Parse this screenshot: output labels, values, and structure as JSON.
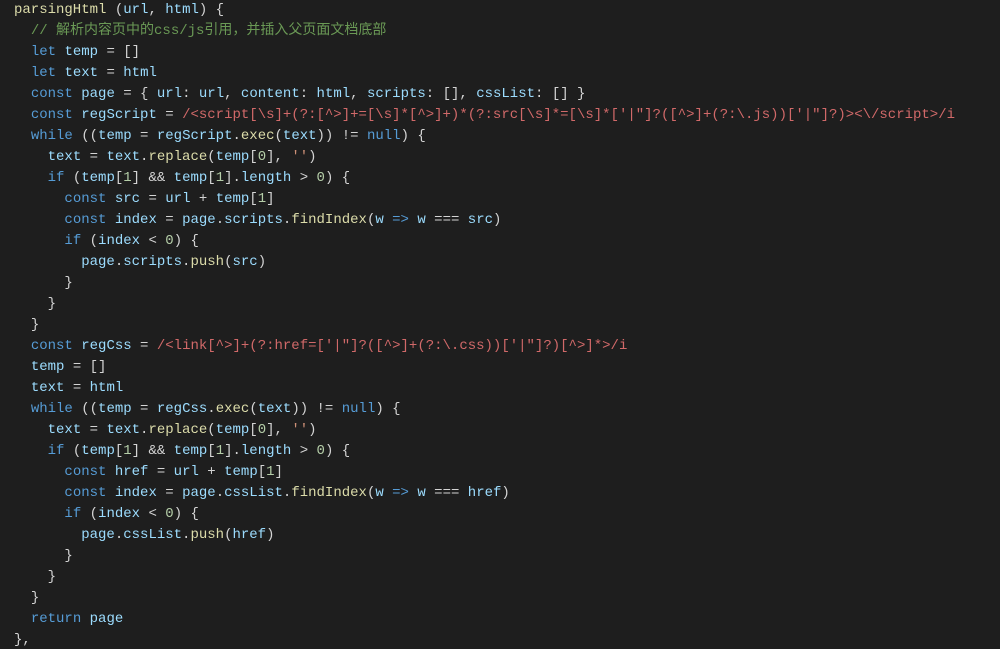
{
  "code": {
    "lines": [
      {
        "i": 0,
        "h": "<span class='fn'>parsingHtml</span><span class='pnc'> (</span><span class='prm'>url</span><span class='pnc'>, </span><span class='prm'>html</span><span class='pnc'>) {</span>"
      },
      {
        "i": 1,
        "h": "<span class='cmt'>// 解析内容页中的css/js引用，并插入父页面文档底部</span>"
      },
      {
        "i": 1,
        "h": "<span class='kw'>let</span><span class='pnc'> </span><span class='prm'>temp</span><span class='pnc'> = []</span>"
      },
      {
        "i": 1,
        "h": "<span class='kw'>let</span><span class='pnc'> </span><span class='prm'>text</span><span class='pnc'> = </span><span class='prm'>html</span>"
      },
      {
        "i": 1,
        "h": "<span class='kw'>const</span><span class='pnc'> </span><span class='prm'>page</span><span class='pnc'> = { </span><span class='prm'>url</span><span class='pnc'>: </span><span class='prm'>url</span><span class='pnc'>, </span><span class='prm'>content</span><span class='pnc'>: </span><span class='prm'>html</span><span class='pnc'>, </span><span class='prm'>scripts</span><span class='pnc'>: [], </span><span class='prm'>cssList</span><span class='pnc'>: [] }</span>"
      },
      {
        "i": 1,
        "h": "<span class='kw'>const</span><span class='pnc'> </span><span class='prm'>regScript</span><span class='pnc'> = </span><span class='rgx'>/&lt;script[\\s]+(?:[^&gt;]+=[\\s]*[^&gt;]+)*(?:src[\\s]*=[\\s]*['|\"]?([^&gt;]+(?:\\.js))['|\"]?)&gt;&lt;\\/script&gt;/i</span>"
      },
      {
        "i": 1,
        "h": "<span class='kw'>while</span><span class='pnc'> ((</span><span class='prm'>temp</span><span class='pnc'> = </span><span class='prm'>regScript</span><span class='pnc'>.</span><span class='fn'>exec</span><span class='pnc'>(</span><span class='prm'>text</span><span class='pnc'>)) != </span><span class='kw'>null</span><span class='pnc'>) {</span>"
      },
      {
        "i": 2,
        "h": "<span class='prm'>text</span><span class='pnc'> = </span><span class='prm'>text</span><span class='pnc'>.</span><span class='fn'>replace</span><span class='pnc'>(</span><span class='prm'>temp</span><span class='pnc'>[</span><span class='num'>0</span><span class='pnc'>], </span><span class='str'>''</span><span class='pnc'>)</span>"
      },
      {
        "i": 2,
        "h": "<span class='kw'>if</span><span class='pnc'> (</span><span class='prm'>temp</span><span class='pnc'>[</span><span class='num'>1</span><span class='pnc'>] &amp;&amp; </span><span class='prm'>temp</span><span class='pnc'>[</span><span class='num'>1</span><span class='pnc'>].</span><span class='prm'>length</span><span class='pnc'> &gt; </span><span class='num'>0</span><span class='pnc'>) {</span>"
      },
      {
        "i": 3,
        "h": "<span class='kw'>const</span><span class='pnc'> </span><span class='prm'>src</span><span class='pnc'> = </span><span class='prm'>url</span><span class='pnc'> + </span><span class='prm'>temp</span><span class='pnc'>[</span><span class='num'>1</span><span class='pnc'>]</span>"
      },
      {
        "i": 3,
        "h": "<span class='kw'>const</span><span class='pnc'> </span><span class='prm'>index</span><span class='pnc'> = </span><span class='prm'>page</span><span class='pnc'>.</span><span class='prm'>scripts</span><span class='pnc'>.</span><span class='fn'>findIndex</span><span class='pnc'>(</span><span class='prm'>w</span><span class='pnc'> </span><span class='kw'>=&gt;</span><span class='pnc'> </span><span class='prm'>w</span><span class='pnc'> === </span><span class='prm'>src</span><span class='pnc'>)</span>"
      },
      {
        "i": 3,
        "h": "<span class='kw'>if</span><span class='pnc'> (</span><span class='prm'>index</span><span class='pnc'> &lt; </span><span class='num'>0</span><span class='pnc'>) {</span>"
      },
      {
        "i": 4,
        "h": "<span class='prm'>page</span><span class='pnc'>.</span><span class='prm'>scripts</span><span class='pnc'>.</span><span class='fn'>push</span><span class='pnc'>(</span><span class='prm'>src</span><span class='pnc'>)</span>"
      },
      {
        "i": 3,
        "h": "<span class='pnc'>}</span>"
      },
      {
        "i": 2,
        "h": "<span class='pnc'>}</span>"
      },
      {
        "i": 1,
        "h": "<span class='pnc'>}</span>"
      },
      {
        "i": 1,
        "h": "<span class='kw'>const</span><span class='pnc'> </span><span class='prm'>regCss</span><span class='pnc'> = </span><span class='rgx'>/&lt;link[^&gt;]+(?:href=['|\"]?([^&gt;]+(?:\\.css))['|\"]?)[^&gt;]*&gt;/i</span>"
      },
      {
        "i": 1,
        "h": "<span class='prm'>temp</span><span class='pnc'> = []</span>"
      },
      {
        "i": 1,
        "h": "<span class='prm'>text</span><span class='pnc'> = </span><span class='prm'>html</span>"
      },
      {
        "i": 1,
        "h": "<span class='kw'>while</span><span class='pnc'> ((</span><span class='prm'>temp</span><span class='pnc'> = </span><span class='prm'>regCss</span><span class='pnc'>.</span><span class='fn'>exec</span><span class='pnc'>(</span><span class='prm'>text</span><span class='pnc'>)) != </span><span class='kw'>null</span><span class='pnc'>) {</span>"
      },
      {
        "i": 2,
        "h": "<span class='prm'>text</span><span class='pnc'> = </span><span class='prm'>text</span><span class='pnc'>.</span><span class='fn'>replace</span><span class='pnc'>(</span><span class='prm'>temp</span><span class='pnc'>[</span><span class='num'>0</span><span class='pnc'>], </span><span class='str'>''</span><span class='pnc'>)</span>"
      },
      {
        "i": 2,
        "h": "<span class='kw'>if</span><span class='pnc'> (</span><span class='prm'>temp</span><span class='pnc'>[</span><span class='num'>1</span><span class='pnc'>] &amp;&amp; </span><span class='prm'>temp</span><span class='pnc'>[</span><span class='num'>1</span><span class='pnc'>].</span><span class='prm'>length</span><span class='pnc'> &gt; </span><span class='num'>0</span><span class='pnc'>) {</span>"
      },
      {
        "i": 3,
        "h": "<span class='kw'>const</span><span class='pnc'> </span><span class='prm'>href</span><span class='pnc'> = </span><span class='prm'>url</span><span class='pnc'> + </span><span class='prm'>temp</span><span class='pnc'>[</span><span class='num'>1</span><span class='pnc'>]</span>"
      },
      {
        "i": 3,
        "h": "<span class='kw'>const</span><span class='pnc'> </span><span class='prm'>index</span><span class='pnc'> = </span><span class='prm'>page</span><span class='pnc'>.</span><span class='prm'>cssList</span><span class='pnc'>.</span><span class='fn'>findIndex</span><span class='pnc'>(</span><span class='prm'>w</span><span class='pnc'> </span><span class='kw'>=&gt;</span><span class='pnc'> </span><span class='prm'>w</span><span class='pnc'> === </span><span class='prm'>href</span><span class='pnc'>)</span>"
      },
      {
        "i": 3,
        "h": "<span class='kw'>if</span><span class='pnc'> (</span><span class='prm'>index</span><span class='pnc'> &lt; </span><span class='num'>0</span><span class='pnc'>) {</span>"
      },
      {
        "i": 4,
        "h": "<span class='prm'>page</span><span class='pnc'>.</span><span class='prm'>cssList</span><span class='pnc'>.</span><span class='fn'>push</span><span class='pnc'>(</span><span class='prm'>href</span><span class='pnc'>)</span>"
      },
      {
        "i": 3,
        "h": "<span class='pnc'>}</span>"
      },
      {
        "i": 2,
        "h": "<span class='pnc'>}</span>"
      },
      {
        "i": 1,
        "h": "<span class='pnc'>}</span>"
      },
      {
        "i": 1,
        "h": "<span class='kw'>return</span><span class='pnc'> </span><span class='prm'>page</span>"
      },
      {
        "i": 0,
        "h": "<span class='pnc'>},</span>"
      }
    ],
    "indent_unit": "  "
  }
}
